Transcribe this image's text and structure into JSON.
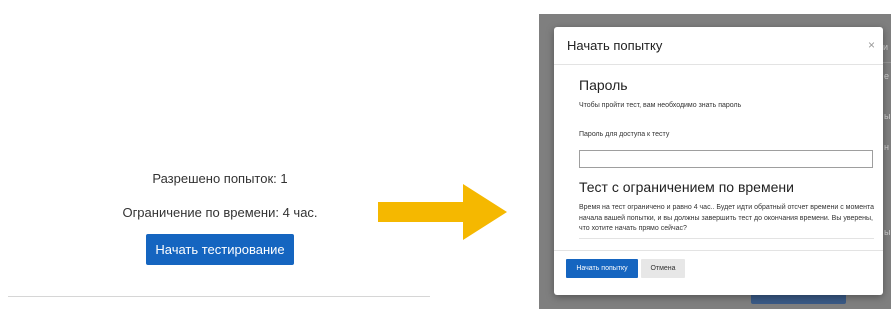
{
  "left": {
    "attempts_allowed": "Разрешено попыток: 1",
    "time_limit": "Ограничение по времени: 4 час.",
    "start_button": "Начать тестирование"
  },
  "arrow": {
    "color": "#f5b800"
  },
  "modal": {
    "title": "Начать попытку",
    "close_glyph": "×",
    "password_section": {
      "title": "Пароль",
      "description": "Чтобы пройти тест, вам необходимо знать пароль",
      "field_label": "Пароль для доступа к тесту",
      "field_value": ""
    },
    "time_section": {
      "title": "Тест с ограничением по времени",
      "description": "Время на тест ограничено и равно 4 час.. Будет идти обратный отсчет времени с момента начала вашей попытки, и вы должны завершить тест до окончания времени. Вы уверены, что хотите начать прямо сейчас?"
    },
    "buttons": {
      "start": "Начать попытку",
      "cancel": "Отмена"
    }
  },
  "colors": {
    "primary": "#1565c0",
    "overlay": "#7f7f7f"
  }
}
